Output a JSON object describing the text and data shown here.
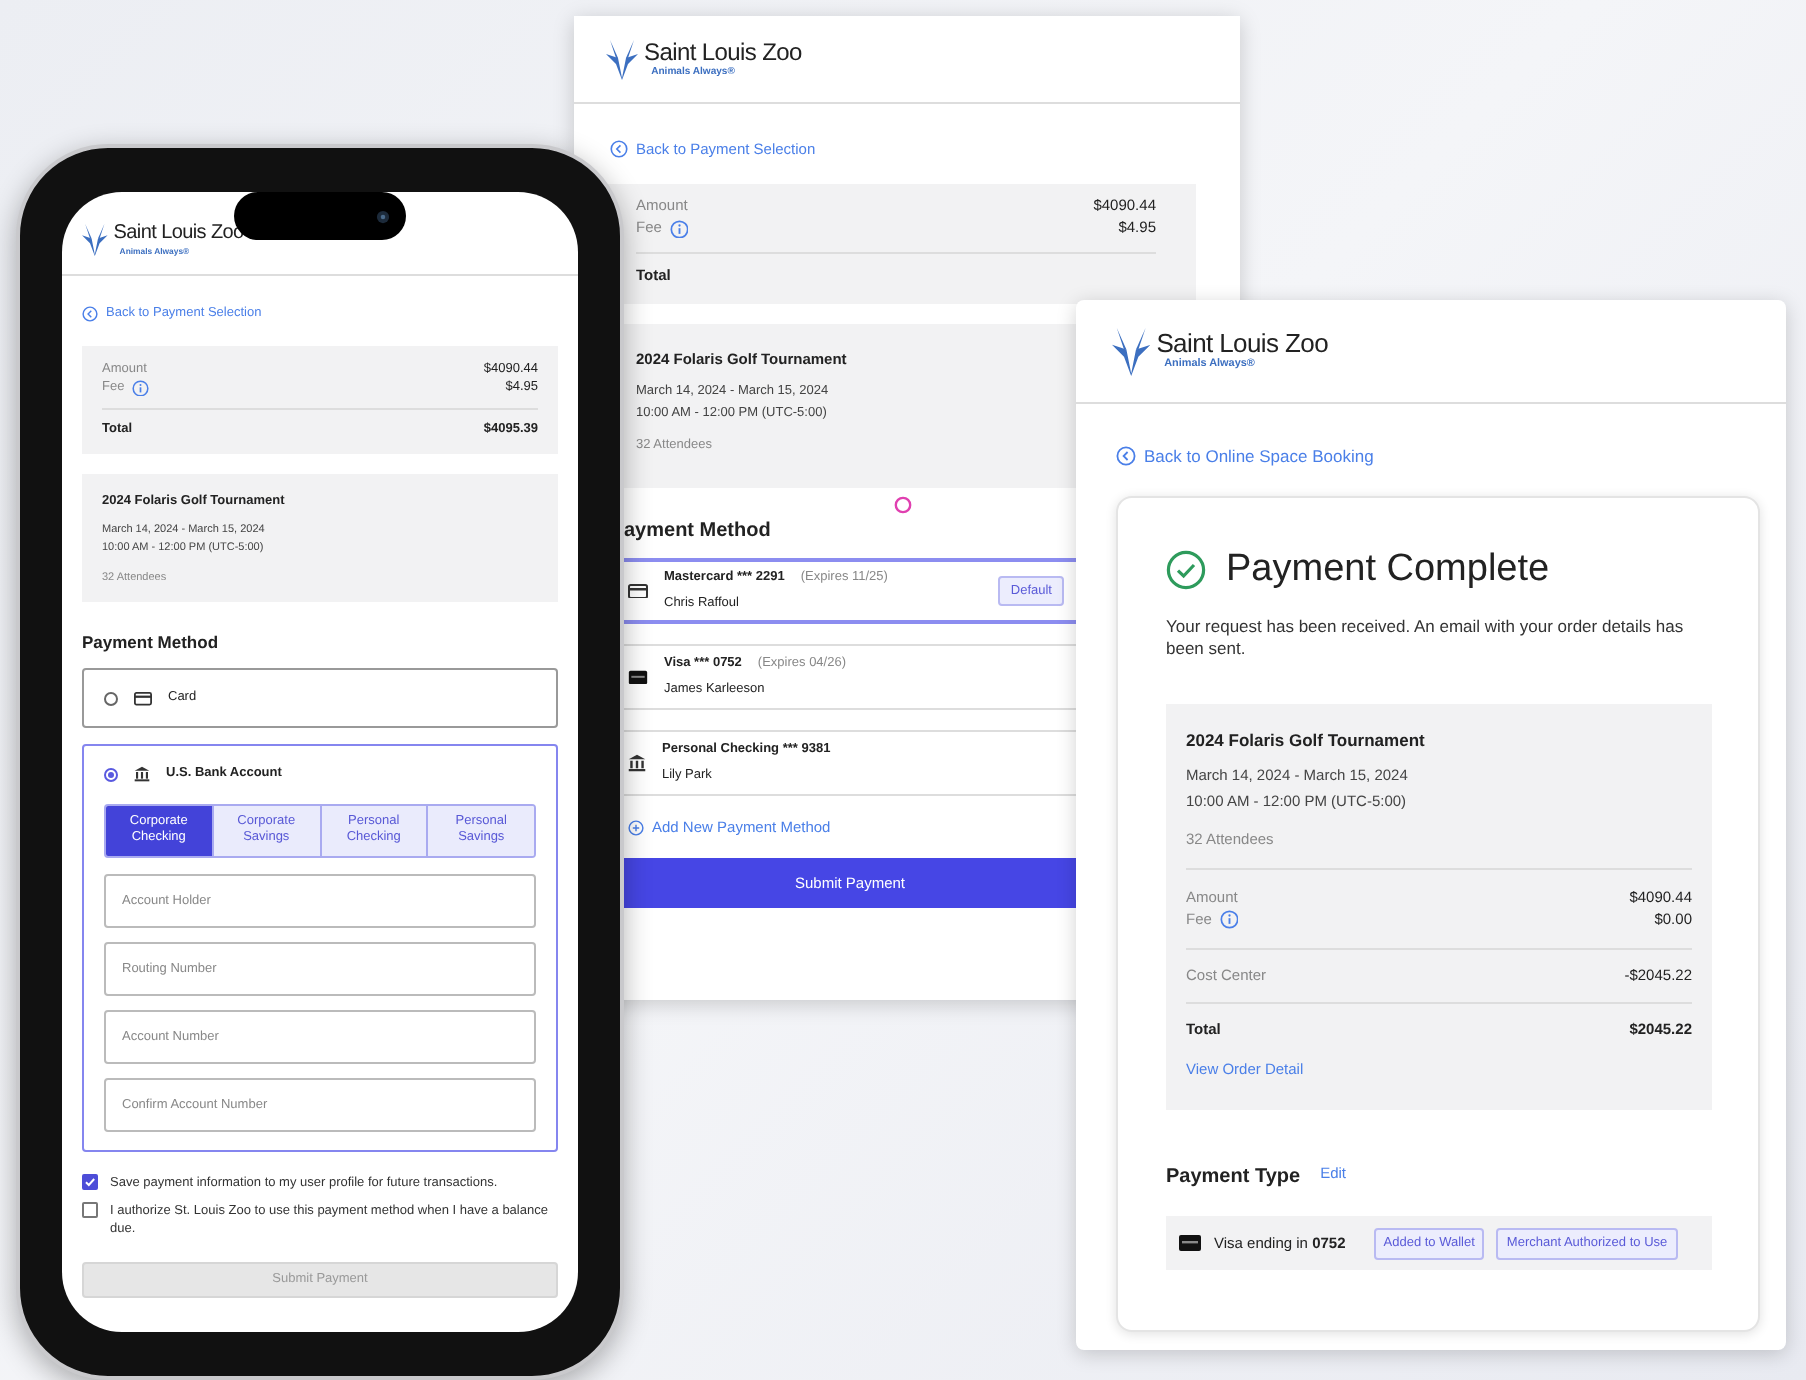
{
  "middle_window": {
    "logo": {
      "name": "Saint Louis Zoo",
      "tagline": "Animals Always®"
    },
    "back_link": "Back to Payment Selection",
    "summary": [
      [
        {
          "label": "Amount",
          "value": "$4090.44",
          "info": false,
          "kind": "line"
        },
        {
          "label": "Fee",
          "value": "$4.95",
          "info": true,
          "kind": "line"
        }
      ],
      [
        {
          "label": "Total",
          "kind": "total",
          "info": false
        }
      ]
    ],
    "event": {
      "title": "2024 Folaris Golf Tournament",
      "dates": "March 14, 2024 - March 15, 2024",
      "time": "10:00 AM - 12:00 PM (UTC-5:00)",
      "attendees": "32 Attendees"
    },
    "heading": "ayment Method",
    "payment_methods": [
      {
        "kind": "card",
        "title": "Mastercard *** 2291",
        "expires": "(Expires 11/25)",
        "holder": "Chris Raffoul",
        "badge": "Default",
        "selected": true
      },
      {
        "kind": "card",
        "title": "Visa *** 0752",
        "expires": "(Expires 04/26)",
        "holder": "James Karleeson",
        "selected": false
      },
      {
        "kind": "bank",
        "title": "Personal Checking *** 9381",
        "holder": "Lily Park",
        "selected": false
      }
    ],
    "add_link": "Add New Payment Method",
    "submit": {
      "label": "Submit Payment",
      "disabled": false
    }
  },
  "confirmation_window": {
    "logo": {
      "name": "Saint Louis Zoo",
      "tagline": "Animals Always®"
    },
    "back_link": "Back to Online Space Booking",
    "title": "Payment Complete",
    "message": "Your request has been received. An email with your order details has been sent.",
    "event": {
      "title": "2024 Folaris Golf Tournament",
      "dates": "March 14, 2024 - March 15, 2024",
      "time": "10:00 AM - 12:00 PM (UTC-5:00)",
      "attendees": "32 Attendees"
    },
    "summary": [
      [
        {
          "label": "Amount",
          "value": "$4090.44",
          "info": false,
          "kind": "line"
        },
        {
          "label": "Fee",
          "value": "$0.00",
          "info": true,
          "kind": "line"
        }
      ],
      [
        {
          "label": "Cost Center",
          "value": "-$2045.22",
          "info": false,
          "kind": "line"
        }
      ],
      [
        {
          "label": "Total",
          "value": "$2045.22",
          "info": false,
          "kind": "total"
        }
      ]
    ],
    "order_link": "View Order Detail",
    "payment_type": {
      "heading": "Payment Type",
      "edit": "Edit",
      "card": "Visa ending in **0752**",
      "badges": [
        "Added to Wallet",
        "Merchant Authorized to Use"
      ]
    }
  },
  "phone": {
    "logo": {
      "name": "Saint Louis Zoo",
      "tagline": "Animals Always®"
    },
    "back_link": "Back to Payment Selection",
    "summary": [
      [
        {
          "label": "Amount",
          "value": "$4090.44",
          "info": false,
          "kind": "line"
        },
        {
          "label": "Fee",
          "value": "$4.95",
          "info": true,
          "kind": "line"
        }
      ],
      [
        {
          "label": "Total",
          "value": "$4095.39",
          "info": false,
          "kind": "total"
        }
      ]
    ],
    "event": {
      "title": "2024 Folaris Golf Tournament",
      "dates": "March 14, 2024 - March 15, 2024",
      "time": "10:00 AM - 12:00 PM (UTC-5:00)",
      "attendees": "32 Attendees"
    },
    "heading": "Payment Method",
    "payment_options": [
      {
        "kind": "card",
        "label": "Card",
        "selected": false
      },
      {
        "kind": "bank",
        "label": "U.S. Bank Account",
        "selected": true,
        "tabs": [
          {
            "label": "Corporate Checking",
            "selected": true
          },
          {
            "label": "Corporate Savings",
            "selected": false
          },
          {
            "label": "Personal Checking",
            "selected": false
          },
          {
            "label": "Personal Savings",
            "selected": false
          }
        ],
        "fields": [
          {
            "placeholder": "Account Holder"
          },
          {
            "placeholder": "Routing Number"
          },
          {
            "placeholder": "Account Number"
          },
          {
            "placeholder": "Confirm Account Number"
          }
        ]
      }
    ],
    "checkboxes": [
      {
        "label": "Save payment information to my user profile for future transactions.",
        "checked": true
      },
      {
        "label": "I authorize St. Louis Zoo to use this payment method when I have a balance due.",
        "checked": false
      }
    ],
    "submit": {
      "label": "Submit Payment",
      "disabled": true
    }
  }
}
